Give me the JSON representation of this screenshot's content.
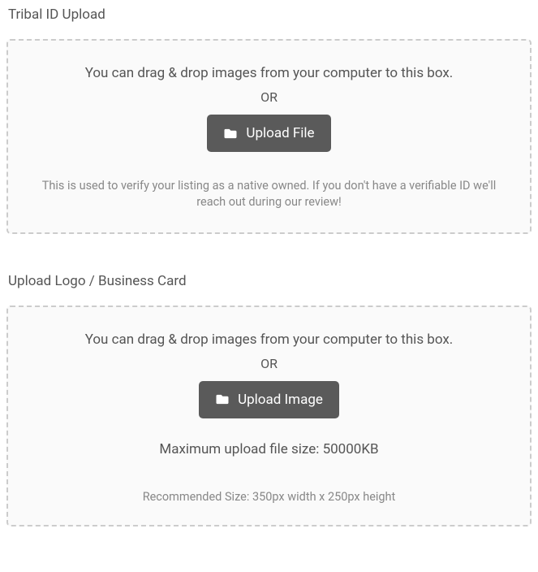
{
  "section1": {
    "title": "Tribal ID Upload",
    "drop_text": "You can drag & drop images from your computer to this box.",
    "or_text": "OR",
    "button_label": "Upload File",
    "helper_text": "This is used to verify your listing as a native owned. If you don't have a verifiable ID we'll reach out during our review!"
  },
  "section2": {
    "title": "Upload Logo / Business Card",
    "drop_text": "You can drag & drop images from your computer to this box.",
    "or_text": "OR",
    "button_label": "Upload Image",
    "max_size_text": "Maximum upload file size: 50000KB",
    "recommended_text": "Recommended Size: 350px width x 250px height"
  }
}
